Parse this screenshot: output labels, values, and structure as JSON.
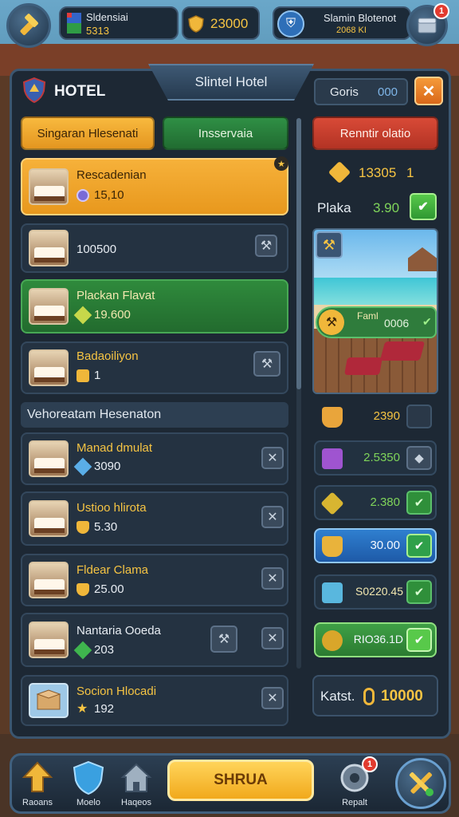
{
  "topbar": {
    "player_name": "Sldensiai",
    "player_sub": "5313",
    "gold": "23000",
    "rank_title": "Slamin Blotenot",
    "rank_sub": "2068 ΚΙ",
    "notif_count": "1"
  },
  "panel": {
    "title": "Slintel Hotel",
    "heading": "HOTEL",
    "sort_label": "Goris",
    "sort_value": "000",
    "close_symbol": "✕"
  },
  "tabs": {
    "reservation": "Singaran Hlesenati",
    "reserve": "Insservaia",
    "right_tab": "Renntir olatio"
  },
  "rooms": [
    {
      "name": "Rescadenian",
      "value": "15,10"
    },
    {
      "name": "",
      "value": "100500"
    },
    {
      "name": "Plackan Flavat",
      "value": "19.600"
    },
    {
      "name": "Badaoiliyon",
      "value": "1"
    }
  ],
  "section_title": "Vehoreatam Hesenaton",
  "reservations": [
    {
      "name": "Manad dmulat",
      "value": "3090"
    },
    {
      "name": "Ustioo hlirota",
      "value": "5.30"
    },
    {
      "name": "Fldear Clama",
      "value": "25.00"
    },
    {
      "name": "Nantaria Ooeda",
      "value": "203"
    },
    {
      "name": "Socion Hlocadi",
      "value": "192"
    }
  ],
  "right": {
    "coins": "13305",
    "coins_suffix": "1",
    "plaka_label": "Plaka",
    "plaka_value": "3.90",
    "card_label": "Faml",
    "card_value": "0006",
    "items": [
      {
        "value": "2390",
        "color": "#e9a53b"
      },
      {
        "value": "2.5350",
        "color": "#9f54d0"
      },
      {
        "value": "2.380",
        "color": "#d8b531"
      },
      {
        "value": "30.00",
        "color": "#3fa6e2"
      },
      {
        "value": "S0220.45",
        "color": "#59b7de"
      },
      {
        "value": "RIO36.1D",
        "color": "#d9a62a"
      }
    ],
    "total_label": "Katst.",
    "total_value": "10000"
  },
  "bottomnav": {
    "item1": "Raoans",
    "item2": "Moelo",
    "item3": "Haqeos",
    "main_button": "SHRUA",
    "item5": "Repalt",
    "badge": "1"
  }
}
